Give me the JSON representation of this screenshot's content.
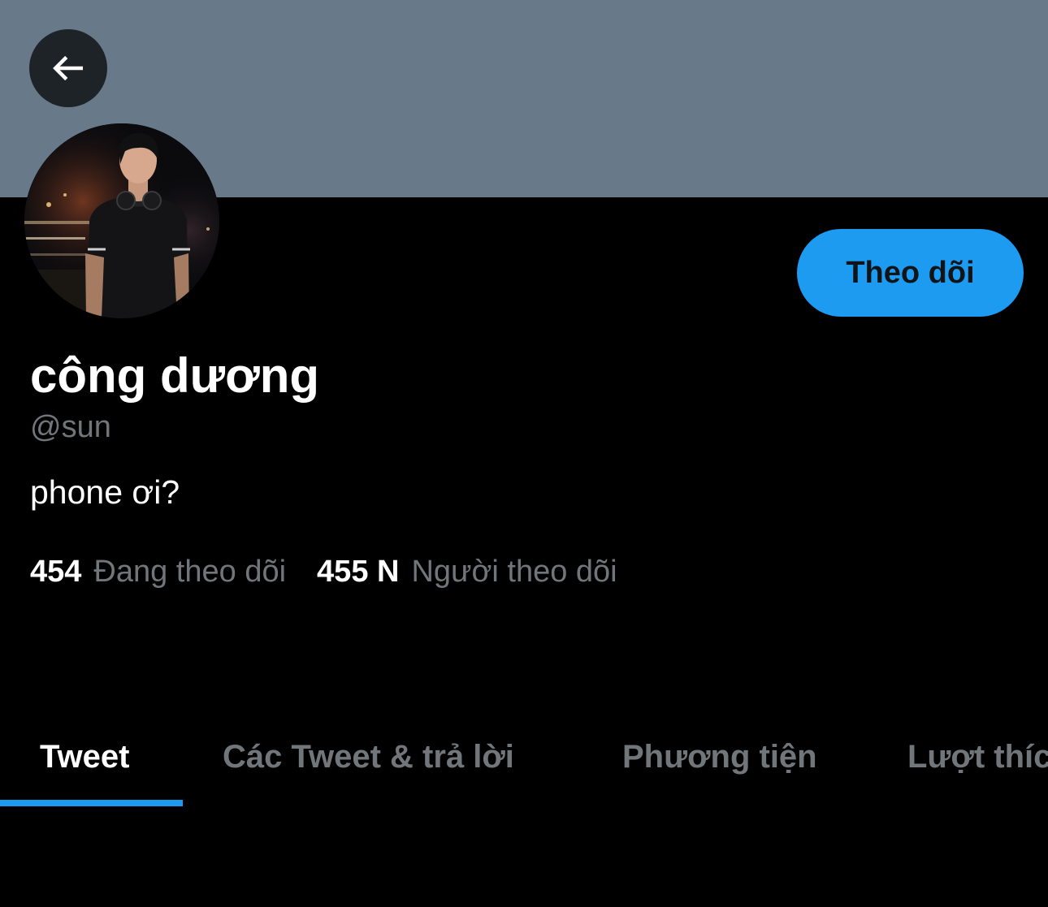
{
  "profile": {
    "display_name": "công dương",
    "handle": "@sun",
    "bio": "phone ơi?",
    "follow_button_label": "Theo dõi",
    "banner_color": "#687a8a",
    "accent_color": "#1d9bf0"
  },
  "navigation": {
    "back_icon": "arrow-left-icon"
  },
  "stats": {
    "following_count": "454",
    "following_label": "Đang theo dõi",
    "followers_count": "455 N",
    "followers_label": "Người theo dõi"
  },
  "tabs": [
    {
      "label": "Tweet",
      "active": true
    },
    {
      "label": "Các Tweet & trả lời",
      "active": false
    },
    {
      "label": "Phương tiện",
      "active": false
    },
    {
      "label": "Lượt thích",
      "active": false
    }
  ]
}
